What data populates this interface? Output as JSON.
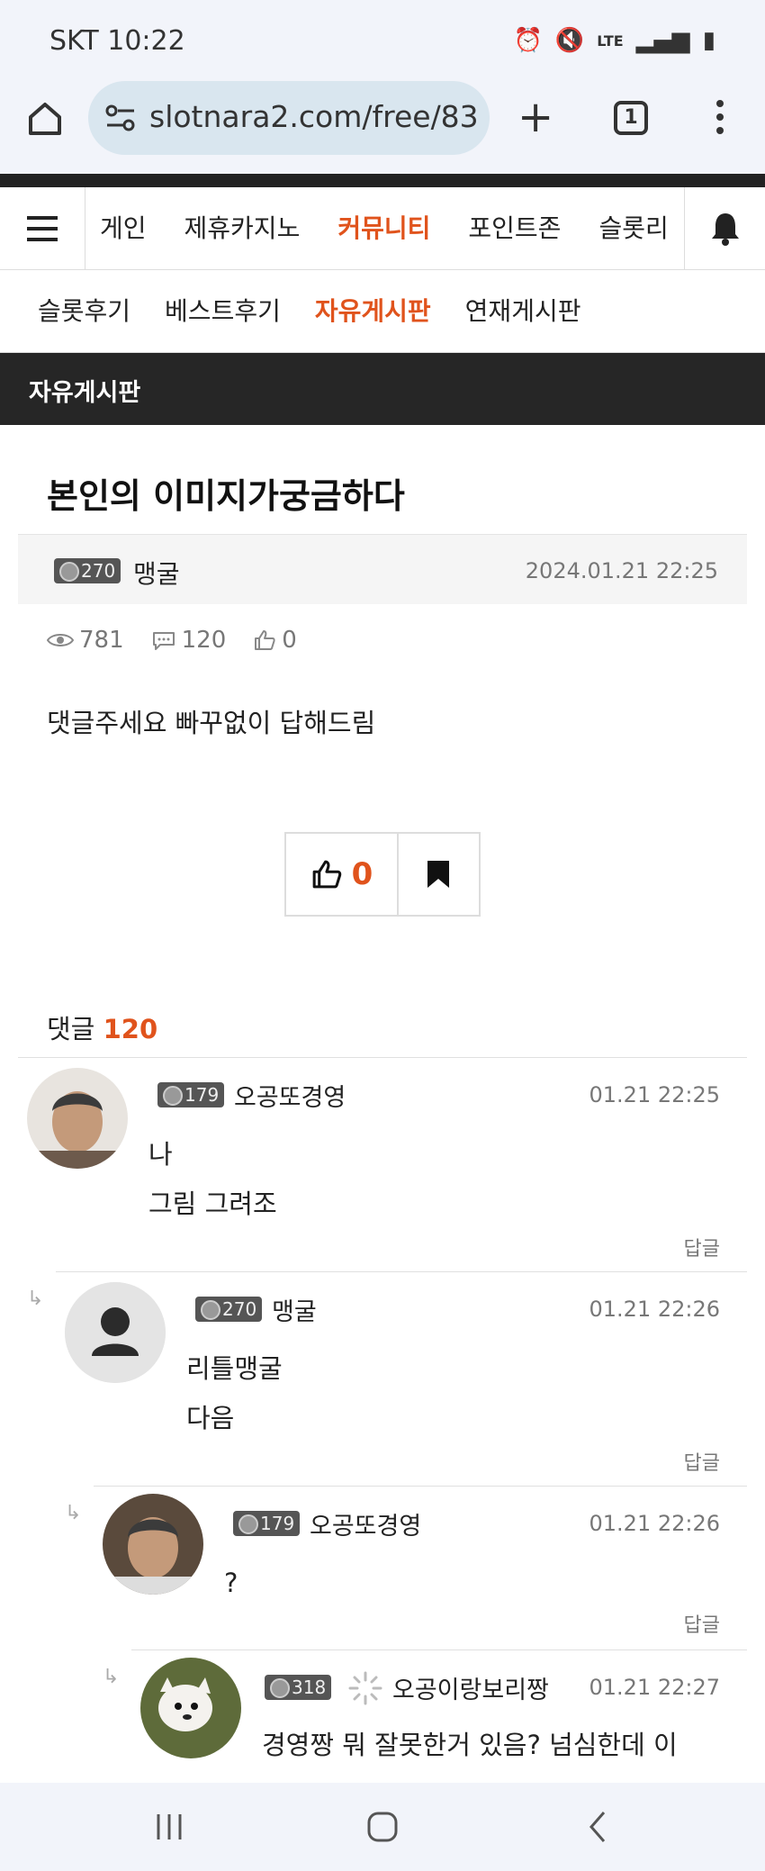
{
  "status_bar": {
    "carrier_time": "SKT 10:22",
    "network": "LTE"
  },
  "browser": {
    "url": "slotnara2.com/free/83",
    "tab_count": "1"
  },
  "main_nav": {
    "items": [
      "게인",
      "제휴카지노",
      "커뮤니티",
      "포인트존",
      "슬롯리"
    ],
    "active_index": 2
  },
  "sub_nav": {
    "items": [
      "슬롯후기",
      "베스트후기",
      "자유게시판",
      "연재게시판"
    ],
    "active_index": 2
  },
  "board_title": "자유게시판",
  "post": {
    "title": "본인의 이미지가궁금하다",
    "author_level": "270",
    "author": "맹굴",
    "date": "2024.01.21 22:25",
    "views": "781",
    "comments": "120",
    "likes": "0",
    "body": "댓글주세요 빠꾸없이 답해드림",
    "like_button_count": "0"
  },
  "comments_section": {
    "label": "댓글",
    "count": "120"
  },
  "comments": [
    {
      "level": "179",
      "name": "오공또경영",
      "time": "01.21 22:25",
      "lines": [
        "나",
        "그림 그려조"
      ],
      "reply": "답글"
    },
    {
      "level": "270",
      "name": "맹굴",
      "time": "01.21 22:26",
      "lines": [
        "리틀맹굴",
        "다음"
      ],
      "reply": "답글"
    },
    {
      "level": "179",
      "name": "오공또경영",
      "time": "01.21 22:26",
      "lines": [
        "?"
      ],
      "reply": "답글"
    },
    {
      "level": "318",
      "name": "오공이랑보리짱",
      "time": "01.21 22:27",
      "lines": [
        "경영짱 뭐 잘못한거 있음? 넘심한데 이"
      ],
      "reply": ""
    }
  ],
  "reply_arrow": "↳",
  "colors": {
    "accent": "#e0531c",
    "board_bar": "#262626"
  }
}
